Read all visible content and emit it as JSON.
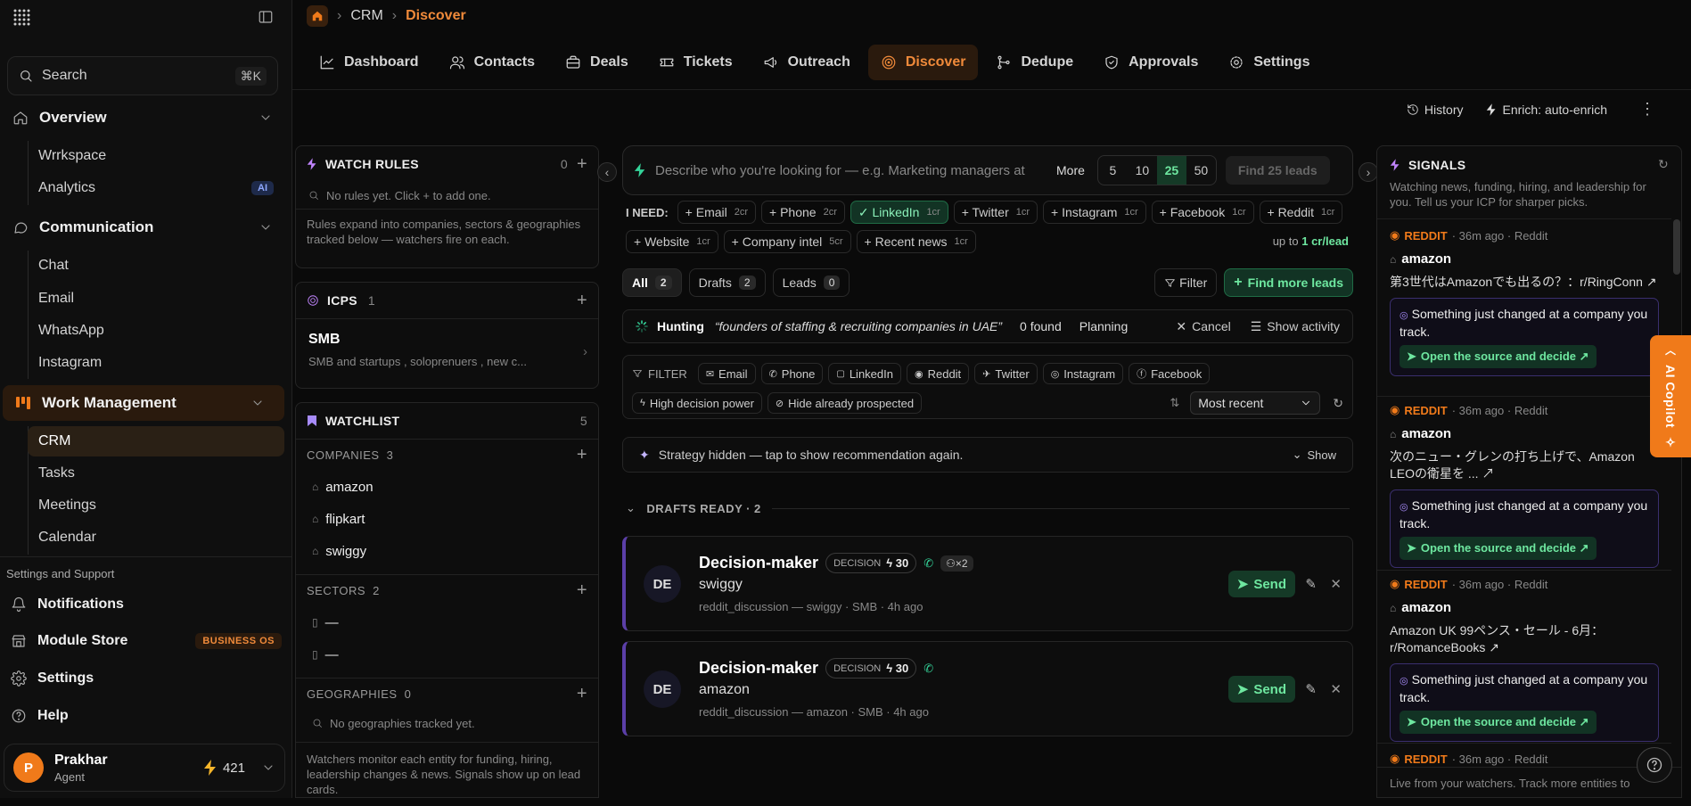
{
  "sidebar": {
    "search_label": "Search",
    "search_shortcut": "⌘K",
    "sections": {
      "overview": "Overview",
      "communication": "Communication",
      "work_management": "Work Management"
    },
    "overview_items": [
      "Wrrkspace",
      "Analytics"
    ],
    "analytics_badge": "AI",
    "communication_items": [
      "Chat",
      "Email",
      "WhatsApp",
      "Instagram"
    ],
    "work_items": [
      "CRM",
      "Tasks",
      "Meetings",
      "Calendar"
    ],
    "support_heading": "Settings and Support",
    "support_items": {
      "notifications": "Notifications",
      "module_store": "Module Store",
      "module_store_badge": "BUSINESS OS",
      "settings": "Settings",
      "help": "Help"
    },
    "user": {
      "initial": "P",
      "name": "Prakhar",
      "role": "Agent",
      "credits": "421"
    }
  },
  "breadcrumb": {
    "items": [
      "CRM",
      "Discover"
    ]
  },
  "nav_tabs": [
    "Dashboard",
    "Contacts",
    "Deals",
    "Tickets",
    "Outreach",
    "Discover",
    "Dedupe",
    "Approvals",
    "Settings"
  ],
  "toolbar": {
    "history": "History",
    "enrich": "Enrich: auto-enrich"
  },
  "watch_rules": {
    "title": "WATCH RULES",
    "count": "0",
    "empty": "No rules yet. Click + to add one.",
    "note": "Rules expand into companies, sectors & geographies tracked below — watchers fire on each."
  },
  "icps": {
    "title": "ICPS",
    "count": "1",
    "item_title": "SMB",
    "item_desc": "SMB and startups , soloprenuers , new c..."
  },
  "watchlist": {
    "title": "WATCHLIST",
    "count": "5",
    "companies_label": "COMPANIES",
    "companies_count": "3",
    "companies": [
      "amazon",
      "flipkart",
      "swiggy"
    ],
    "sectors_label": "SECTORS",
    "sectors_count": "2",
    "sectors": [
      "—",
      "—"
    ],
    "geo_label": "GEOGRAPHIES",
    "geo_count": "0",
    "geo_empty": "No geographies tracked yet.",
    "footer": "Watchers monitor each entity for funding, hiring, leadership changes & news. Signals show up on lead cards."
  },
  "discover": {
    "search_placeholder": "Describe who you're looking for — e.g. Marketing managers at",
    "more_label": "More",
    "counts": [
      "5",
      "10",
      "25",
      "50"
    ],
    "selected_count": "25",
    "find_label": "Find 25 leads",
    "need_label": "I NEED:",
    "needs_row1": [
      {
        "label": "+ Email",
        "cost": "2cr"
      },
      {
        "label": "+ Phone",
        "cost": "2cr"
      },
      {
        "label": "✓ LinkedIn",
        "cost": "1cr"
      },
      {
        "label": "+ Twitter",
        "cost": "1cr"
      },
      {
        "label": "+ Instagram",
        "cost": "1cr"
      },
      {
        "label": "+ Facebook",
        "cost": "1cr"
      },
      {
        "label": "+ Reddit",
        "cost": "1cr"
      }
    ],
    "needs_row2": [
      {
        "label": "+ Website",
        "cost": "1cr"
      },
      {
        "label": "+ Company intel",
        "cost": "5cr"
      },
      {
        "label": "+ Recent news",
        "cost": "1cr"
      }
    ],
    "cost_prefix": "up to",
    "cost_value": "1 cr/lead",
    "views": [
      {
        "label": "All",
        "count": "2"
      },
      {
        "label": "Drafts",
        "count": "2"
      },
      {
        "label": "Leads",
        "count": "0"
      }
    ],
    "filter_label": "Filter",
    "find_more_label": "Find more leads",
    "hunting": {
      "label": "Hunting",
      "query": "“founders of staffing & recruiting companies in UAE”",
      "found": "0 found",
      "status": "Planning",
      "cancel": "Cancel",
      "activity": "Show activity"
    },
    "filter_title": "FILTER",
    "filter_chips": [
      "Email",
      "Phone",
      "LinkedIn",
      "Reddit",
      "Twitter",
      "Instagram",
      "Facebook"
    ],
    "filter_chips2": [
      "High decision power",
      "Hide already prospected"
    ],
    "sort_value": "Most recent",
    "strategy_text": "Strategy hidden — tap to show recommendation again.",
    "strategy_show": "Show",
    "drafts_heading": "DRAFTS READY · 2",
    "leads": [
      {
        "initials": "DE",
        "title": "Decision-maker",
        "decision_label": "DECISION",
        "score": "30",
        "extra": "×2",
        "company": "swiggy",
        "meta": "reddit_discussion — swiggy · SMB · 4h ago",
        "send": "Send"
      },
      {
        "initials": "DE",
        "title": "Decision-maker",
        "decision_label": "DECISION",
        "score": "30",
        "extra": "",
        "company": "amazon",
        "meta": "reddit_discussion — amazon · SMB · 4h ago",
        "send": "Send"
      }
    ]
  },
  "signals": {
    "title": "SIGNALS",
    "subtitle": "Watching news, funding, hiring, and leadership for you. Tell us your ICP for sharper picks.",
    "items": [
      {
        "source": "REDDIT",
        "time": "· 36m ago · Reddit",
        "company": "amazon",
        "body": "第3世代はAmazonでも出るの？：r/RingConn ↗",
        "alert": "Something just changed at a company you track.",
        "action": "Open the source and decide ↗"
      },
      {
        "source": "REDDIT",
        "time": "· 36m ago · Reddit",
        "company": "amazon",
        "body": "次のニュー・グレンの打ち上げで、Amazon LEOの衛星を ... ↗",
        "alert": "Something just changed at a company you track.",
        "action": "Open the source and decide ↗"
      },
      {
        "source": "REDDIT",
        "time": "· 36m ago · Reddit",
        "company": "amazon",
        "body": "Amazon UK 99ペンス・セール - 6月：r/RomanceBooks ↗",
        "alert": "Something just changed at a company you track.",
        "action": "Open the source and decide ↗"
      },
      {
        "source": "REDDIT",
        "time": "· 36m ago · Reddit",
        "company": "",
        "body": "",
        "alert": "",
        "action": ""
      }
    ],
    "footer": "Live from your watchers. Track more entities to"
  },
  "copilot": {
    "label": "AI Copilot"
  },
  "colors": {
    "accent": "#f07a1a",
    "green": "#6ee7a0",
    "purple": "#5b3fa8"
  }
}
